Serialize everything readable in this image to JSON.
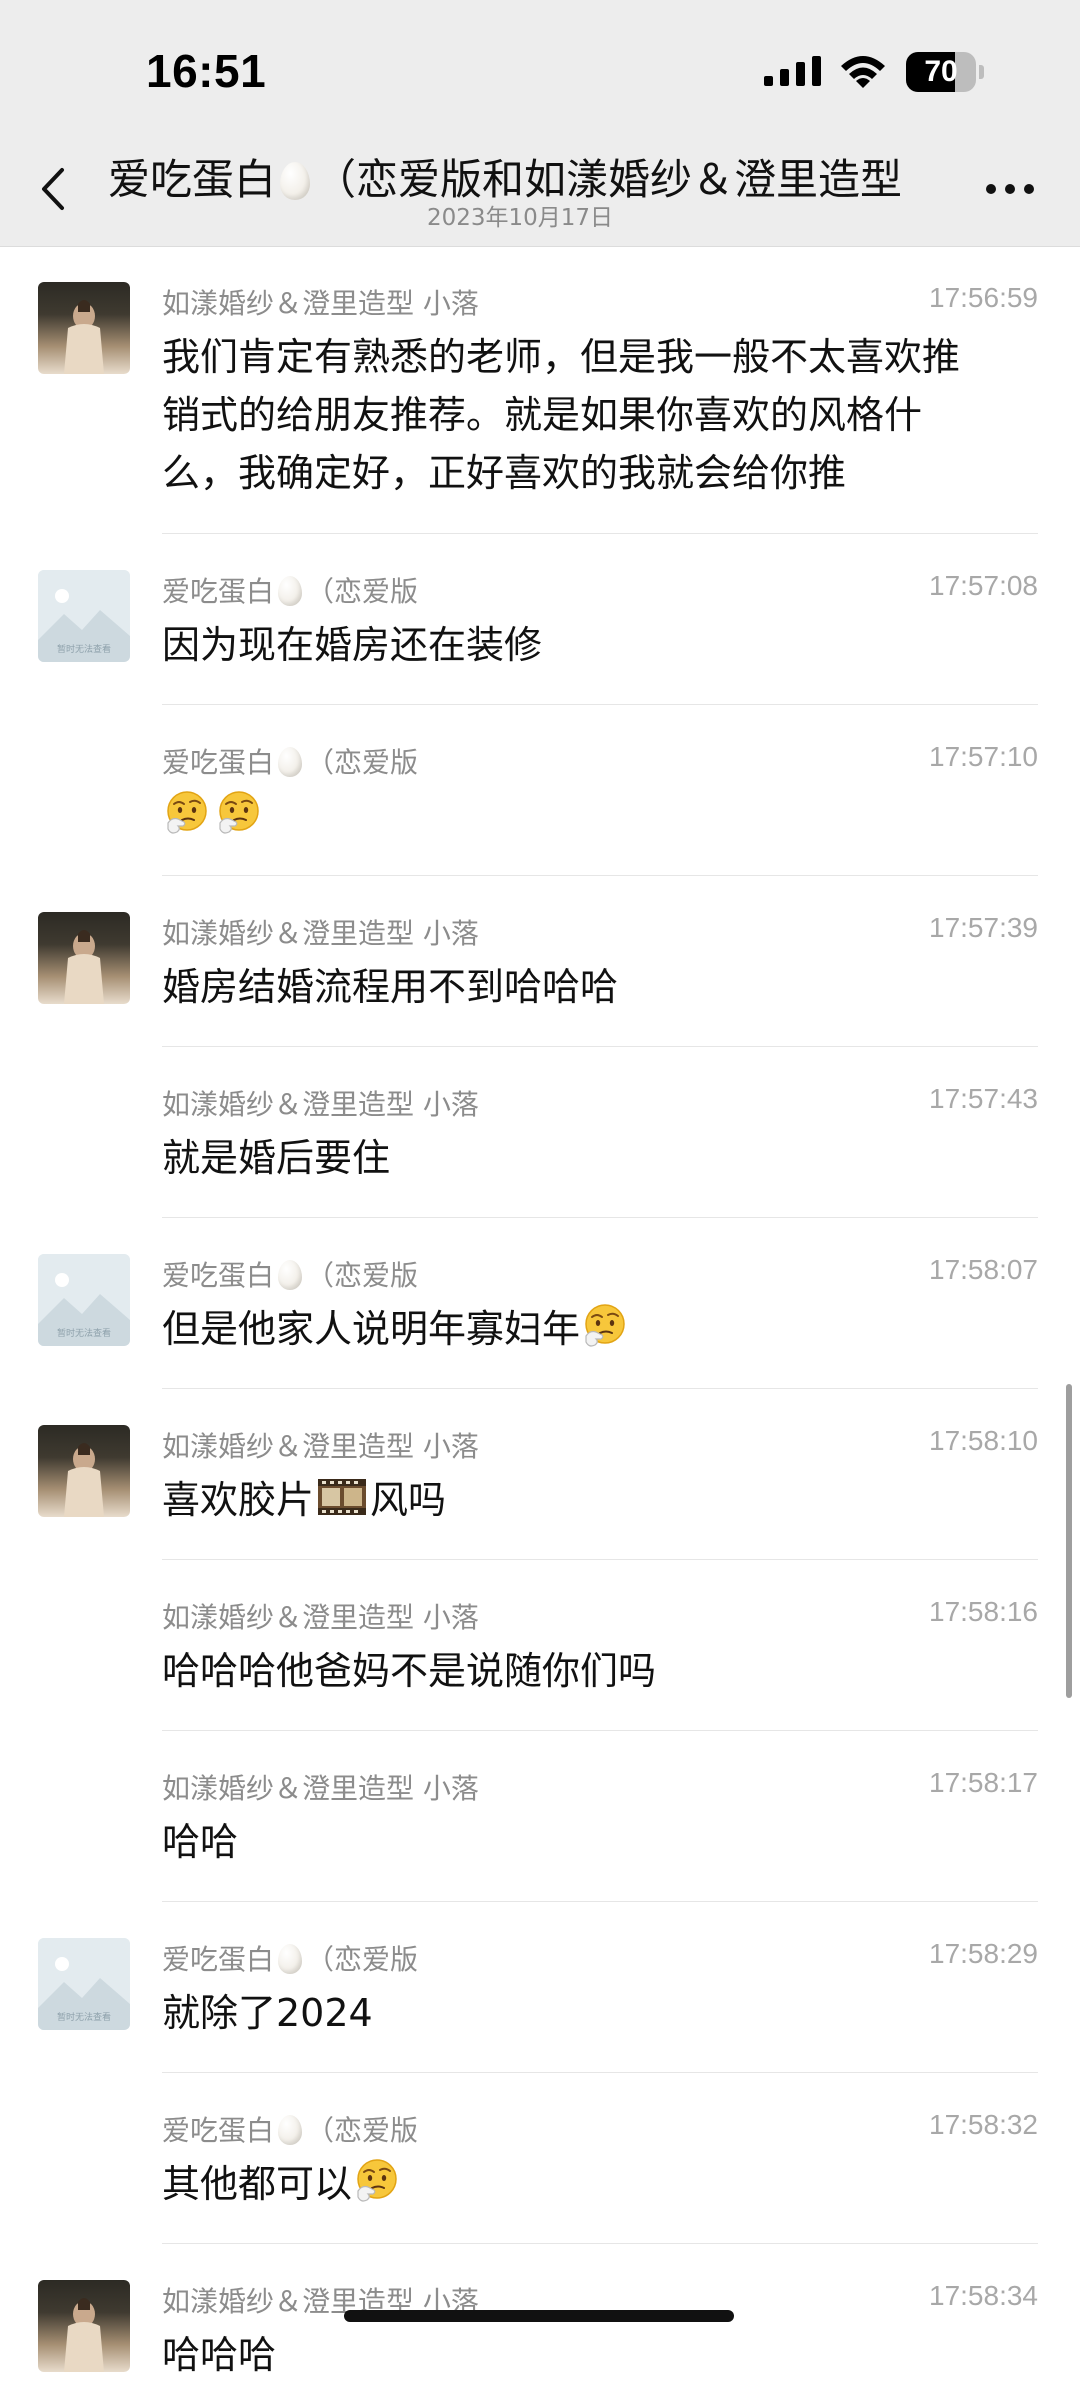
{
  "status_bar": {
    "time": "16:51",
    "battery": "70",
    "battery_level": 0.7,
    "icons": [
      "cellular-signal-icon",
      "wifi-icon",
      "battery-icon"
    ]
  },
  "nav": {
    "title_prefix": "爱吃蛋白",
    "title_suffix": "（恋爱版和如漾婚纱＆澄里造型",
    "date": "2023年10月17日",
    "icons": [
      "back-icon",
      "egg-icon",
      "more-icon"
    ]
  },
  "colors": {
    "header_bg": "#ededed",
    "sender_gray": "#8c8c8c",
    "time_gray": "#a8a8a8",
    "divider": "#e6e6e6"
  },
  "messages": [
    {
      "sender": "如漾婚纱＆澄里造型 小落",
      "time": "17:56:59",
      "avatar": "photo",
      "lines": [
        "我们肯定有熟悉的老师，但是我一般不太喜欢推",
        "销式的给朋友推荐。就是如果你喜欢的风格什",
        "么，我确定好，正好喜欢的我就会给你推"
      ]
    },
    {
      "sender_prefix": "爱吃蛋白",
      "sender_suffix": "（恋爱版",
      "time": "17:57:08",
      "avatar": "placeholder",
      "avatar_text": "暂时无法查看",
      "text": "因为现在婚房还在装修"
    },
    {
      "sender_prefix": "爱吃蛋白",
      "sender_suffix": "（恋爱版",
      "time": "17:57:10",
      "avatar": "none",
      "emoji": [
        "thinking-face-emoji",
        "thinking-face-emoji"
      ]
    },
    {
      "sender": "如漾婚纱＆澄里造型 小落",
      "time": "17:57:39",
      "avatar": "photo",
      "text": "婚房结婚流程用不到哈哈哈"
    },
    {
      "sender": "如漾婚纱＆澄里造型 小落",
      "time": "17:57:43",
      "avatar": "none",
      "text": "就是婚后要住"
    },
    {
      "sender_prefix": "爱吃蛋白",
      "sender_suffix": "（恋爱版",
      "time": "17:58:07",
      "avatar": "placeholder",
      "avatar_text": "暂时无法查看",
      "text": "但是他家人说明年寡妇年",
      "emoji": [
        "thinking-face-emoji"
      ]
    },
    {
      "sender": "如漾婚纱＆澄里造型 小落",
      "time": "17:58:10",
      "avatar": "photo",
      "text_before": "喜欢胶片",
      "text_after": "风吗",
      "emoji": [
        "film-icon"
      ]
    },
    {
      "sender": "如漾婚纱＆澄里造型 小落",
      "time": "17:58:16",
      "avatar": "none",
      "text": "哈哈哈他爸妈不是说随你们吗"
    },
    {
      "sender": "如漾婚纱＆澄里造型 小落",
      "time": "17:58:17",
      "avatar": "none",
      "text": "哈哈"
    },
    {
      "sender_prefix": "爱吃蛋白",
      "sender_suffix": "（恋爱版",
      "time": "17:58:29",
      "avatar": "placeholder",
      "avatar_text": "暂时无法查看",
      "text": "就除了2024"
    },
    {
      "sender_prefix": "爱吃蛋白",
      "sender_suffix": "（恋爱版",
      "time": "17:58:32",
      "avatar": "none",
      "text": "其他都可以",
      "emoji": [
        "thinking-face-emoji"
      ]
    },
    {
      "sender": "如漾婚纱＆澄里造型 小落",
      "time": "17:58:34",
      "avatar": "photo",
      "text": "哈哈哈"
    }
  ]
}
